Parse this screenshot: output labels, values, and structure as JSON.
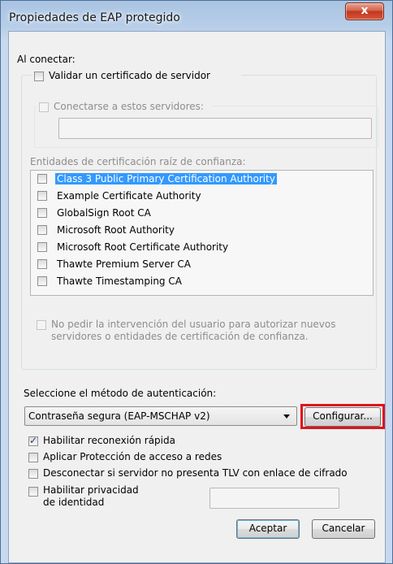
{
  "window": {
    "title": "Propiedades de EAP protegido",
    "close_label": "x"
  },
  "connect": {
    "heading": "Al conectar:",
    "validate_cert_label": "Validar un certificado de servidor",
    "connect_servers_label": "Conectarse a estos servidores:",
    "servers_value": "",
    "root_ca_label": "Entidades de certificación raíz de confianza:",
    "ca_list": [
      "Class 3 Public Primary Certification Authority",
      "Example Certificate Authority",
      "GlobalSign Root CA",
      "Microsoft Root Authority",
      "Microsoft Root Certificate Authority",
      "Thawte Premium Server CA",
      "Thawte Timestamping CA"
    ],
    "no_prompt_line1": "No pedir la intervención del usuario para autorizar nuevos",
    "no_prompt_line2": "servidores o entidades de certificación de confianza."
  },
  "auth": {
    "heading": "Seleccione el método de autenticación:",
    "method_value": "Contraseña segura (EAP-MSCHAP v2)",
    "configure_label": "Configurar..."
  },
  "options": {
    "fast_reconnect": "Habilitar reconexión rápida",
    "nap": "Aplicar Protección de acceso a redes",
    "disconnect_tlv": "Desconectar si servidor no presenta TLV con enlace de cifrado",
    "identity_privacy_line1": "Habilitar privacidad",
    "identity_privacy_line2": "de identidad",
    "identity_value": ""
  },
  "footer": {
    "ok_label": "Aceptar",
    "cancel_label": "Cancelar"
  }
}
